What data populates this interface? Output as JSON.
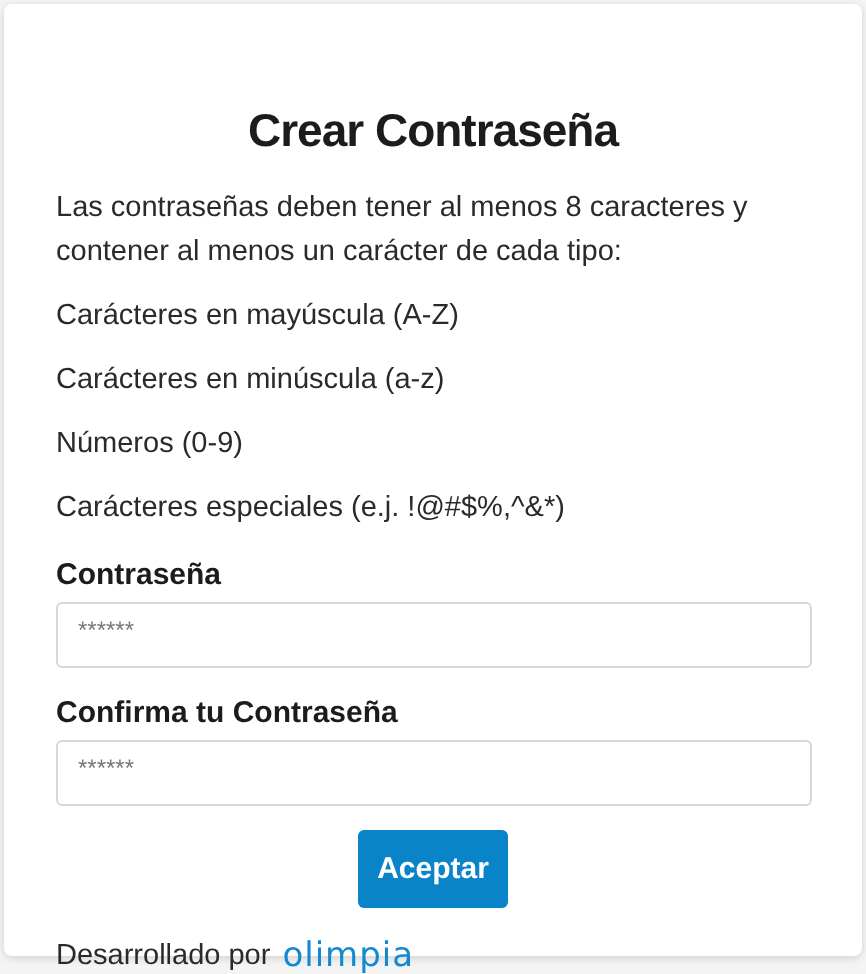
{
  "title": "Crear Contraseña",
  "intro": "Las contraseñas deben tener al menos 8 caracteres y contener al menos un carácter de cada tipo:",
  "requirements": [
    "Carácteres en mayúscula (A-Z)",
    "Carácteres en minúscula (a-z)",
    "Números (0-9)",
    "Carácteres especiales (e.j. !@#$%,^&*)"
  ],
  "fields": [
    {
      "label": "Contraseña",
      "placeholder": "******"
    },
    {
      "label": "Confirma tu Contraseña",
      "placeholder": "******"
    }
  ],
  "button": "Aceptar",
  "footer": {
    "text": "Desarrollado por",
    "logo": "olimpia"
  }
}
